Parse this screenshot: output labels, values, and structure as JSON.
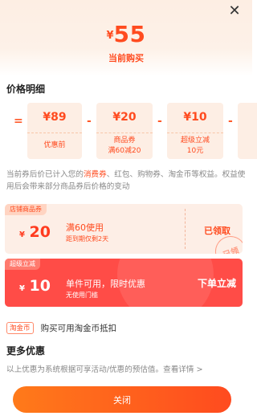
{
  "header": {
    "currency": "¥",
    "price": "55",
    "price_label": "当前购买",
    "close_icon": "close-icon"
  },
  "breakdown": {
    "title": "价格明细",
    "operators": [
      "=",
      "-",
      "-",
      "-"
    ],
    "items": [
      {
        "value": "¥89",
        "label": "优惠前",
        "label2": ""
      },
      {
        "value": "¥20",
        "label": "商品券",
        "label2": "满60减20"
      },
      {
        "value": "¥10",
        "label": "超级立减",
        "label2": "10元"
      }
    ]
  },
  "note": {
    "part1": "当前券后价已计入您的",
    "highlight": "消费券",
    "part2": "、红包、购物券、淘金币等权益。权益使用后会带来部分商品券后价格的变动"
  },
  "coupons": {
    "store": {
      "tag": "店铺商品券",
      "currency": "¥",
      "amount": "20",
      "condition": "满60使用",
      "expiry": "距到期仅剩2天",
      "status": "已领取",
      "stamp": "已领"
    },
    "super": {
      "tag": "超级立减",
      "currency": "¥",
      "amount": "10",
      "condition": "单件可用，限时优惠",
      "threshold": "无使用门槛",
      "action": "下单立减"
    }
  },
  "coin": {
    "tag": "淘金币",
    "text": "购买可用淘金币抵扣"
  },
  "more": {
    "title": "更多优惠",
    "note": "以上优惠为系统根据可享活动/优惠的预估值。查看详情 >"
  },
  "footer": {
    "close_label": "关闭"
  },
  "colors": {
    "accent": "#ff4b1f",
    "super_coupon": "#ff4c47",
    "button_start": "#ff7a1a"
  }
}
